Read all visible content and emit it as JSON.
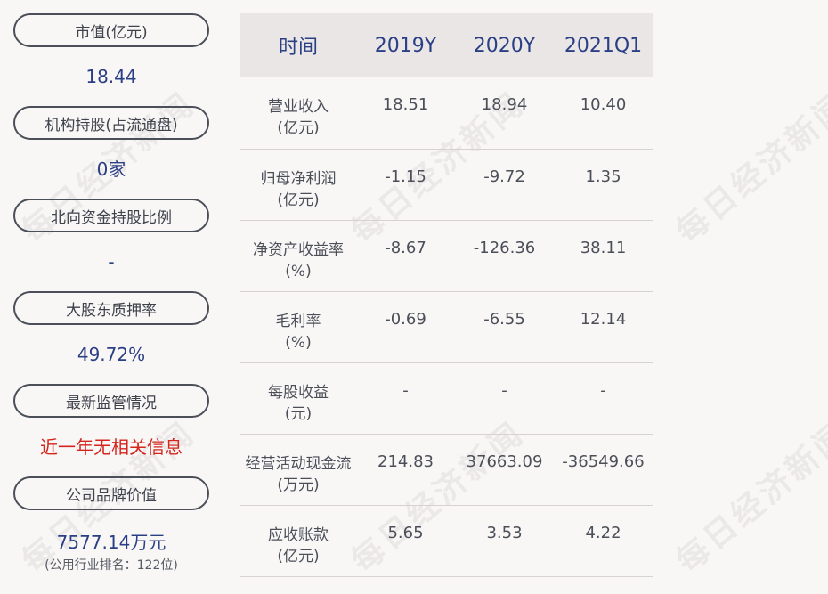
{
  "left_panel": [
    {
      "label": "市值(亿元)",
      "value": "18.44",
      "style": "blue"
    },
    {
      "label": "机构持股(占流通盘)",
      "value": "0家",
      "style": "blue"
    },
    {
      "label": "北向资金持股比例",
      "value": "-",
      "style": "blue"
    },
    {
      "label": "大股东质押率",
      "value": "49.72%",
      "style": "blue"
    },
    {
      "label": "最新监管情况",
      "value": "近一年无相关信息",
      "style": "red"
    },
    {
      "label": "公司品牌价值",
      "value": "7577.14万元",
      "sub": "(公用行业排名：122位)",
      "style": "blue"
    }
  ],
  "table": {
    "headers": [
      "时间",
      "2019Y",
      "2020Y",
      "2021Q1"
    ],
    "rows": [
      {
        "label1": "营业收入",
        "label2": "(亿元)",
        "values": [
          "18.51",
          "18.94",
          "10.40"
        ]
      },
      {
        "label1": "归母净利润",
        "label2": "(亿元)",
        "values": [
          "-1.15",
          "-9.72",
          "1.35"
        ]
      },
      {
        "label1": "净资产收益率",
        "label2": "(%)",
        "values": [
          "-8.67",
          "-126.36",
          "38.11"
        ]
      },
      {
        "label1": "毛利率",
        "label2": "(%)",
        "values": [
          "-0.69",
          "-6.55",
          "12.14"
        ]
      },
      {
        "label1": "每股收益",
        "label2": "(元)",
        "values": [
          "-",
          "-",
          "-"
        ]
      },
      {
        "label1": "经营活动现金流",
        "label2": "(万元)",
        "values": [
          "214.83",
          "37663.09",
          "-36549.66"
        ]
      },
      {
        "label1": "应收账款",
        "label2": "(亿元)",
        "values": [
          "5.65",
          "3.53",
          "4.22"
        ]
      }
    ]
  },
  "watermark": "每日经济新闻",
  "colors": {
    "accent_blue": "#2b3f85",
    "alert_red": "#d4261d",
    "header_bg": "#ebe6e6",
    "page_bg": "#f9f6f6"
  }
}
